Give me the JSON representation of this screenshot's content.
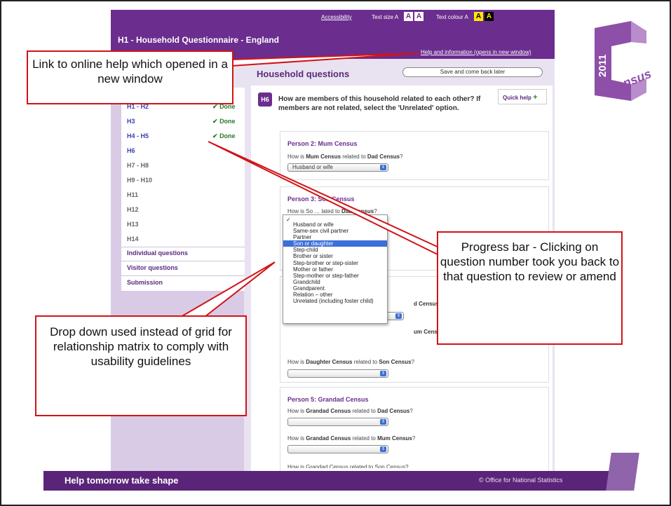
{
  "header": {
    "accessibility": "Accessibility",
    "text_size_label": "Text size",
    "text_colour_label": "Text colour",
    "a_small": "A",
    "a_box1": "A",
    "a_box2": "A",
    "a_colour1": "A",
    "a_colour2": "A",
    "a_colour3": "A",
    "title": "H1 - Household Questionnaire - England",
    "help_link": "Help and information (opens in new window)"
  },
  "main": {
    "title": "Household questions",
    "save_button": "Save and come back later",
    "question_number": "H6",
    "question_text": "How are members of this household related to each other? If members are not related, select the 'Unrelated' option.",
    "quick_help": "Quick help",
    "quick_help_icon": "+"
  },
  "nav": {
    "items": [
      {
        "label": "H1 - H2",
        "status": "Done"
      },
      {
        "label": "H3",
        "status": "Done"
      },
      {
        "label": "H4 - H5",
        "status": "Done"
      },
      {
        "label": "H6"
      },
      {
        "label": "H7 - H8"
      },
      {
        "label": "H9 - H10"
      },
      {
        "label": "H11"
      },
      {
        "label": "H12"
      },
      {
        "label": "H13"
      },
      {
        "label": "H14"
      }
    ],
    "sections": [
      "Individual questions",
      "Visitor questions",
      "Submission"
    ]
  },
  "persons": [
    {
      "name": "Person 2: Mum Census",
      "q1_pre": "How is",
      "q1_subject": "Mum Census",
      "q1_mid": "related to",
      "q1_object": "Dad Census",
      "q1_end": "?",
      "q1_value": "Husband or wife"
    },
    {
      "name_visible": "Person 3: Son Census",
      "q1_visible": "How is So",
      "q1_visible2": "lated to",
      "q1_object": "Dad Census",
      "q1_end": "?"
    },
    {
      "q2_visible": "d Census",
      "q3_visible": "um Census?",
      "q4_pre": "How is",
      "q4_subject": "Daughter Census",
      "q4_mid": "related to",
      "q4_object": "Son Census",
      "q4_end": "?"
    },
    {
      "name": "Person 5: Grandad Census",
      "q_pre": "How is",
      "q_subject": "Grandad Census",
      "q_mid": "related to",
      "q1_object": "Dad Census",
      "q2_object": "Mum Census",
      "q3_object_visible": "Son Census",
      "q_end": "?",
      "q3_visible": "How is Grandad Census related to Son Census?"
    }
  ],
  "dropdown": {
    "check": "✓",
    "options": [
      "Husband or wife",
      "Same-sex civil partner",
      "Partner",
      "Son or daughter",
      "Step-child",
      "Brother or sister",
      "Step-brother or step-sister",
      "Mother or father",
      "Step-mother or step-father",
      "Grandchild",
      "Grandparent",
      "Relation – other",
      "Unrelated (including foster child)"
    ],
    "selected": "Son or daughter"
  },
  "callouts": {
    "help": "Link to online help which opened in a new window",
    "progress": "Progress bar - Clicking on question number took you back to that question to review or amend",
    "dropdown": "Drop down used instead of grid for relationship matrix to comply with usability guidelines"
  },
  "logo": {
    "year": "2011",
    "letter": "C",
    "word": "Census"
  },
  "footer": {
    "tagline": "Help tomorrow take shape",
    "credit": "© Office for National Statistics"
  },
  "colors": {
    "brand": "#6b2d8e",
    "callout_border": "#d01418",
    "done": "#2a7a2a"
  }
}
